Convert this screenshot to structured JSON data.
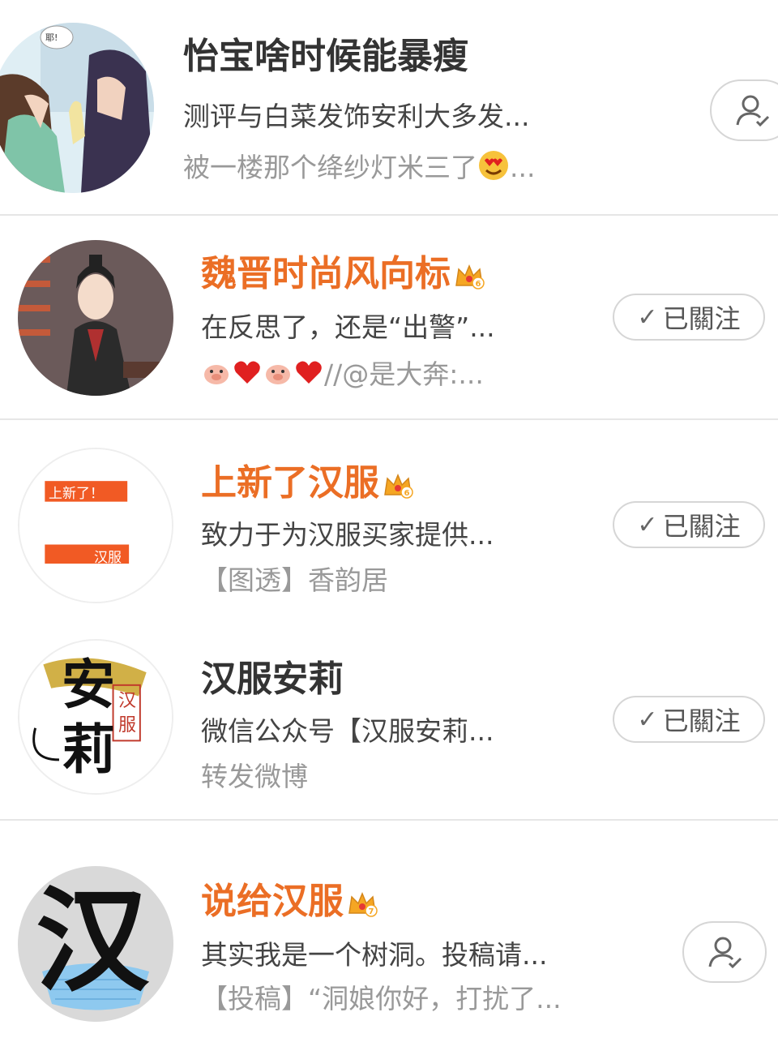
{
  "users": [
    {
      "name": "怡宝啥时候能暴瘦",
      "description": "测评与白菜发饰安利大多发...",
      "latest": "被一楼那个绛纱灯米三了",
      "latest_suffix": "...",
      "avatar_bubble": "耶!",
      "action": "add"
    },
    {
      "name": "魏晋时尚风向标",
      "crown_level": "6",
      "description": "在反思了，还是“出警”...",
      "latest": "//@是大奔:...",
      "action": "following",
      "follow_label": "已關注"
    },
    {
      "name": "上新了汉服",
      "crown_level": "6",
      "description": "致力于为汉服买家提供...",
      "latest": "【图透】香韵居",
      "avatar_text_top": "上新了！",
      "avatar_text_bottom": "汉服",
      "action": "following",
      "follow_label": "已關注"
    },
    {
      "name": "汉服安莉",
      "description": "微信公众号【汉服安莉...",
      "latest": "转发微博",
      "avatar_text": "安莉",
      "avatar_seal": "汉服",
      "action": "following",
      "follow_label": "已關注"
    },
    {
      "name": "说给汉服",
      "crown_level": "7",
      "description": "其实我是一个树洞。投稿请...",
      "latest": "【投稿】“洞娘你好，打扰了...",
      "avatar_text": "汉",
      "action": "add"
    }
  ],
  "colors": {
    "vip_name": "#eb6e25",
    "crown": "#f5a623",
    "heart": "#e02020"
  },
  "icons": {
    "check": "✓",
    "add_user": "user-add-icon",
    "crown": "crown-icon"
  }
}
